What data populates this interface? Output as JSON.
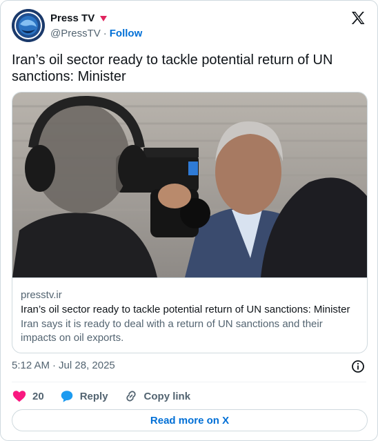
{
  "header": {
    "display_name": "Press TV",
    "handle": "@PressTV",
    "separator": "·",
    "follow_label": "Follow"
  },
  "tweet": {
    "text": "Iran’s oil sector ready to tackle potential return of UN sanctions: Minister"
  },
  "link_card": {
    "domain": "presstv.ir",
    "title": "Iran’s oil sector ready to tackle potential return of UN sanctions: Minister",
    "description": "Iran says it is ready to deal with a return of UN sanctions and their impacts on oil exports."
  },
  "meta": {
    "time": "5:12 AM",
    "separator": "·",
    "date": "Jul 28, 2025"
  },
  "actions": {
    "like_count": "20",
    "reply_label": "Reply",
    "copy_link_label": "Copy link"
  },
  "read_more_label": "Read more on X",
  "colors": {
    "accent": "#006fd6",
    "heart": "#f91880",
    "reply_bubble": "#1d9bf0",
    "muted": "#536471",
    "border": "#cfd9de"
  }
}
